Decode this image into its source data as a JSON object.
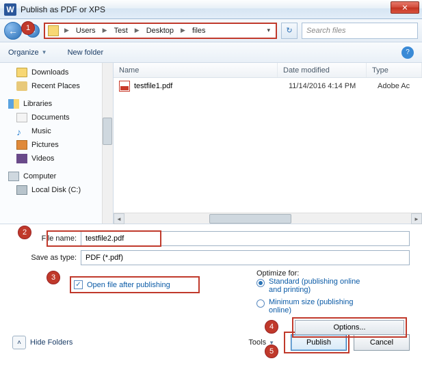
{
  "window": {
    "title": "Publish as PDF or XPS"
  },
  "nav": {
    "breadcrumbs": [
      "Users",
      "Test",
      "Desktop",
      "files"
    ],
    "search_placeholder": "Search files"
  },
  "toolbar": {
    "organize": "Organize",
    "new_folder": "New folder"
  },
  "tree": {
    "downloads": "Downloads",
    "recent": "Recent Places",
    "libraries": "Libraries",
    "documents": "Documents",
    "music": "Music",
    "pictures": "Pictures",
    "videos": "Videos",
    "computer": "Computer",
    "local_disk": "Local Disk (C:)"
  },
  "columns": {
    "name": "Name",
    "date": "Date modified",
    "type": "Type"
  },
  "files": [
    {
      "name": "testfile1.pdf",
      "date": "11/14/2016 4:14 PM",
      "type": "Adobe Ac"
    }
  ],
  "form": {
    "filename_label": "File name:",
    "filename_value": "testfile2.pdf",
    "saveas_label": "Save as type:",
    "saveas_value": "PDF (*.pdf)",
    "open_after_label": "Open file after publishing",
    "optimize_label": "Optimize for:",
    "optimize_standard": "Standard (publishing online and printing)",
    "optimize_minimum": "Minimum size (publishing online)",
    "options_btn": "Options...",
    "hide_folders": "Hide Folders",
    "tools": "Tools",
    "publish": "Publish",
    "cancel": "Cancel"
  },
  "annotations": {
    "a1": "1",
    "a2": "2",
    "a3": "3",
    "a4": "4",
    "a5": "5"
  }
}
